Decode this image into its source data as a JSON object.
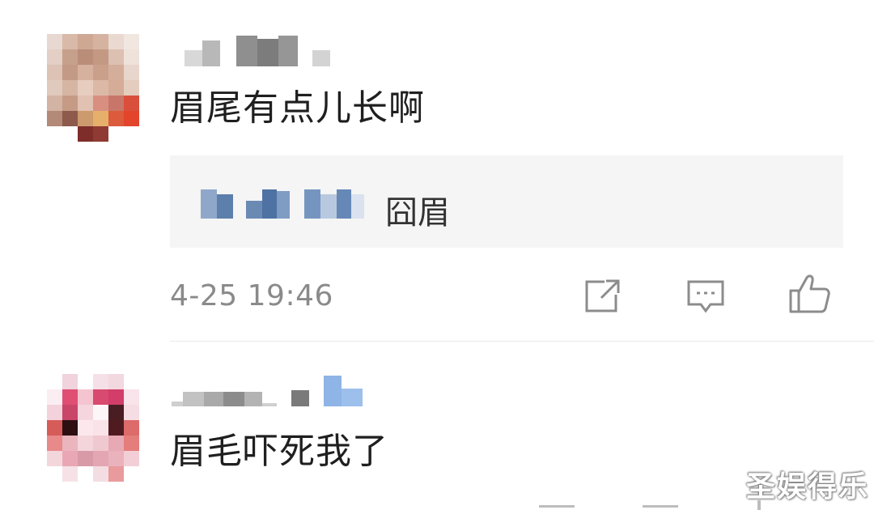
{
  "comments": [
    {
      "text": "眉尾有点儿长啊",
      "reply": {
        "text": "囧眉"
      },
      "timestamp": "4-25 19:46",
      "actions": {
        "share_icon": "share-icon",
        "reply_icon": "comment-icon",
        "like_icon": "thumbs-up-icon"
      }
    },
    {
      "text": "眉毛吓死我了"
    }
  ],
  "watermark": "圣娱得乐",
  "colors": {
    "reply_bg": "#f5f5f5",
    "timestamp": "#8a8a8a",
    "icon": "#8c8c8c"
  }
}
